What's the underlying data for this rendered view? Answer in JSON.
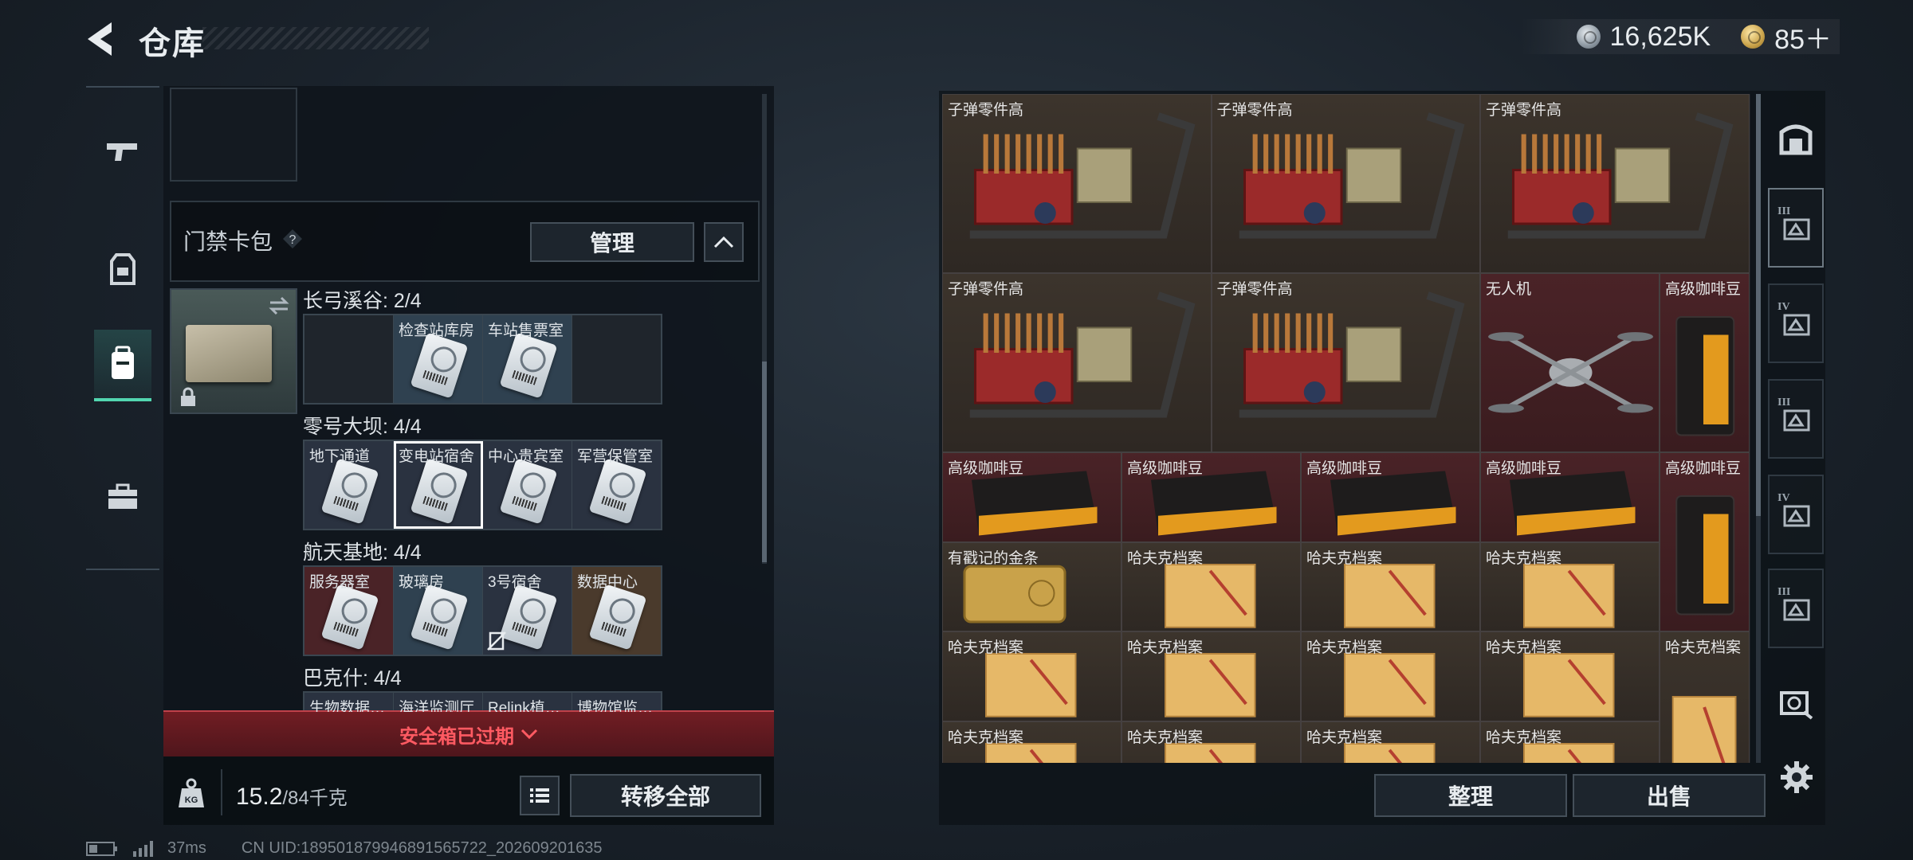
{
  "header": {
    "title": "仓库"
  },
  "currency": {
    "silver": "16,625K",
    "gold": "85＋"
  },
  "left_panel": {
    "card_pack_title": "门禁卡包",
    "manage_label": "管理",
    "regions": [
      {
        "name": "长弓溪谷: 2/4",
        "cells": [
          {
            "label": "",
            "has_card": false,
            "tone": "dark"
          },
          {
            "label": "检查站库房",
            "has_card": true,
            "tone": "blue"
          },
          {
            "label": "车站售票室",
            "has_card": true,
            "tone": "blue"
          },
          {
            "label": "",
            "has_card": false,
            "tone": "dark"
          }
        ]
      },
      {
        "name": "零号大坝: 4/4",
        "cells": [
          {
            "label": "地下通道",
            "has_card": true,
            "tone": "slate"
          },
          {
            "label": "变电站宿舍",
            "has_card": true,
            "tone": "slate",
            "selected": true
          },
          {
            "label": "中心贵宾室",
            "has_card": true,
            "tone": "slate"
          },
          {
            "label": "军营保管室",
            "has_card": true,
            "tone": "slate"
          }
        ]
      },
      {
        "name": "航天基地: 4/4",
        "cells": [
          {
            "label": "服务器室",
            "has_card": true,
            "tone": "red"
          },
          {
            "label": "玻璃房",
            "has_card": true,
            "tone": "blue"
          },
          {
            "label": "3号宿舍",
            "has_card": true,
            "tone": "slate",
            "unavailable": true
          },
          {
            "label": "数据中心",
            "has_card": true,
            "tone": "brown"
          }
        ]
      },
      {
        "name": "巴克什: 4/4",
        "cells": [
          {
            "label": "生物数据…",
            "has_card": true,
            "tone": "slate"
          },
          {
            "label": "海洋监测厅",
            "has_card": true,
            "tone": "slate"
          },
          {
            "label": "Relink植…",
            "has_card": true,
            "tone": "slate"
          },
          {
            "label": "博物馆监…",
            "has_card": true,
            "tone": "slate"
          }
        ]
      }
    ],
    "expired_text": "安全箱已过期",
    "weight_current": "15.2",
    "weight_capacity": "/84千克",
    "transfer_all_label": "转移全部"
  },
  "inventory": {
    "items": [
      {
        "label": "子弹零件高",
        "type": "ammo",
        "tone": "brown",
        "col": 0,
        "row": 0,
        "w": 3,
        "h": 2
      },
      {
        "label": "子弹零件高",
        "type": "ammo",
        "tone": "brown",
        "col": 3,
        "row": 0,
        "w": 3,
        "h": 2
      },
      {
        "label": "子弹零件高",
        "type": "ammo",
        "tone": "brown",
        "col": 6,
        "row": 0,
        "w": 3,
        "h": 2
      },
      {
        "label": "子弹零件高",
        "type": "ammo",
        "tone": "brown",
        "col": 0,
        "row": 2,
        "w": 3,
        "h": 2
      },
      {
        "label": "子弹零件高",
        "type": "ammo",
        "tone": "brown",
        "col": 3,
        "row": 2,
        "w": 3,
        "h": 2
      },
      {
        "label": "无人机",
        "type": "drone",
        "tone": "red",
        "col": 6,
        "row": 2,
        "w": 2,
        "h": 2
      },
      {
        "label": "高级咖啡豆",
        "type": "coffee-bag",
        "tone": "red",
        "col": 8,
        "row": 2,
        "w": 1,
        "h": 2
      },
      {
        "label": "高级咖啡豆",
        "type": "coffee",
        "tone": "red",
        "col": 0,
        "row": 4,
        "w": 2,
        "h": 1
      },
      {
        "label": "高级咖啡豆",
        "type": "coffee",
        "tone": "red",
        "col": 2,
        "row": 4,
        "w": 2,
        "h": 1
      },
      {
        "label": "高级咖啡豆",
        "type": "coffee",
        "tone": "red",
        "col": 4,
        "row": 4,
        "w": 2,
        "h": 1
      },
      {
        "label": "高级咖啡豆",
        "type": "coffee",
        "tone": "red",
        "col": 6,
        "row": 4,
        "w": 2,
        "h": 1
      },
      {
        "label": "高级咖啡豆",
        "type": "coffee-bag",
        "tone": "red",
        "col": 8,
        "row": 4,
        "w": 1,
        "h": 2
      },
      {
        "label": "有戳记的金条",
        "type": "gold",
        "tone": "brown",
        "col": 0,
        "row": 5,
        "w": 2,
        "h": 1
      },
      {
        "label": "哈夫克档案",
        "type": "folder",
        "tone": "brown",
        "col": 2,
        "row": 5,
        "w": 2,
        "h": 1
      },
      {
        "label": "哈夫克档案",
        "type": "folder",
        "tone": "brown",
        "col": 4,
        "row": 5,
        "w": 2,
        "h": 1
      },
      {
        "label": "哈夫克档案",
        "type": "folder",
        "tone": "brown",
        "col": 6,
        "row": 5,
        "w": 2,
        "h": 1
      },
      {
        "label": "哈夫克档案",
        "type": "folder",
        "tone": "brown",
        "col": 0,
        "row": 6,
        "w": 2,
        "h": 1
      },
      {
        "label": "哈夫克档案",
        "type": "folder",
        "tone": "brown",
        "col": 2,
        "row": 6,
        "w": 2,
        "h": 1
      },
      {
        "label": "哈夫克档案",
        "type": "folder",
        "tone": "brown",
        "col": 4,
        "row": 6,
        "w": 2,
        "h": 1
      },
      {
        "label": "哈夫克档案",
        "type": "folder",
        "tone": "brown",
        "col": 6,
        "row": 6,
        "w": 2,
        "h": 1
      },
      {
        "label": "哈夫克档案",
        "type": "folder-tall",
        "tone": "brown",
        "col": 8,
        "row": 6,
        "w": 1,
        "h": 2
      },
      {
        "label": "哈夫克档案",
        "type": "folder",
        "tone": "brown",
        "col": 0,
        "row": 7,
        "w": 2,
        "h": 1
      },
      {
        "label": "哈夫克档案",
        "type": "folder",
        "tone": "brown",
        "col": 2,
        "row": 7,
        "w": 2,
        "h": 1
      },
      {
        "label": "哈夫克档案",
        "type": "folder",
        "tone": "brown",
        "col": 4,
        "row": 7,
        "w": 2,
        "h": 1
      },
      {
        "label": "哈夫克档案",
        "type": "folder",
        "tone": "brown",
        "col": 6,
        "row": 7,
        "w": 2,
        "h": 1
      }
    ],
    "sort_label": "整理",
    "sell_label": "出售"
  },
  "right_nav": {
    "items": [
      {
        "icon": "safe-box-icon",
        "tier": ""
      },
      {
        "icon": "chest-rig-icon",
        "tier": "III"
      },
      {
        "icon": "armor-icon",
        "tier": "IV"
      },
      {
        "icon": "backpack-icon",
        "tier": "III"
      },
      {
        "icon": "container-icon",
        "tier": "IV"
      },
      {
        "icon": "helmet-icon",
        "tier": "III"
      },
      {
        "icon": "secure-case-icon",
        "tier": ""
      }
    ]
  },
  "status_bar": {
    "ping": "37ms",
    "uid": "CN UID:1895018799468915657​22_202609201635"
  },
  "colors": {
    "accent": "#52d6b0",
    "alert": "#ff5a62",
    "item_red": "#4a2327",
    "item_brown": "#3c342c"
  }
}
